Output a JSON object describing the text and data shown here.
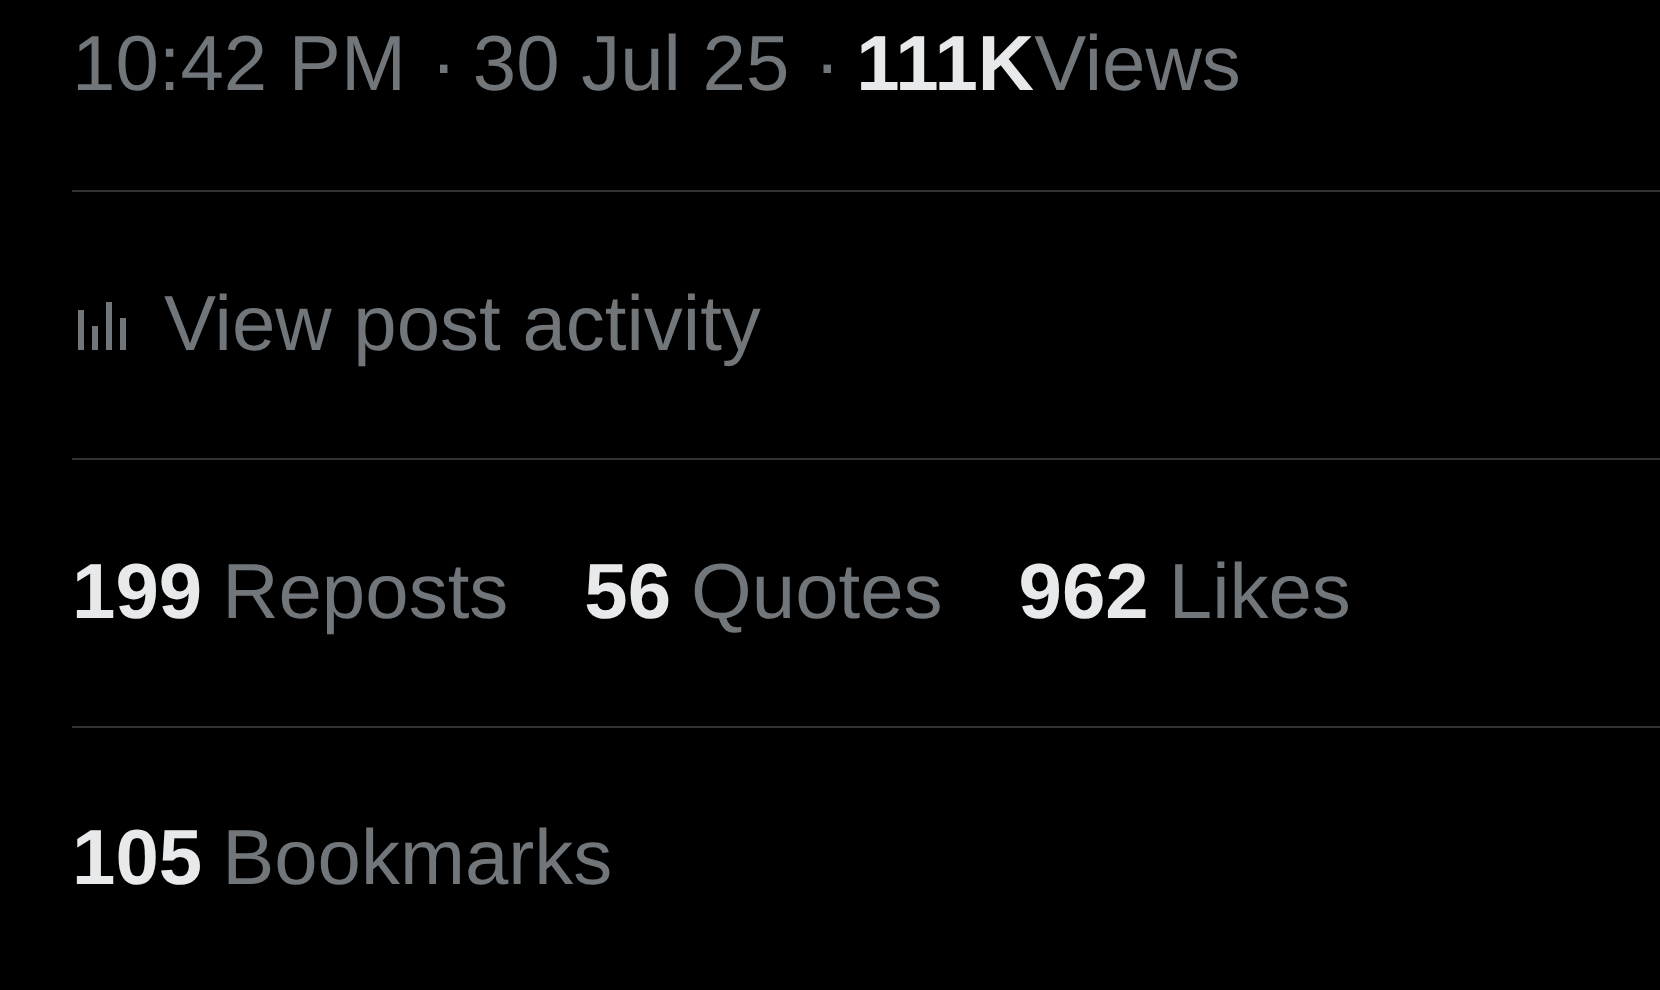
{
  "meta": [
    {
      "kind": "text",
      "text": "10:42 PM"
    },
    {
      "kind": "separator",
      "text": "·"
    },
    {
      "kind": "text",
      "text": "30 Jul 25"
    },
    {
      "kind": "separator",
      "text": "·"
    },
    {
      "kind": "count",
      "text": "111K"
    },
    {
      "kind": "text",
      "text": "Views"
    }
  ],
  "activity_link": {
    "label": "View post activity"
  },
  "stats": [
    {
      "count": "199",
      "label": "Reposts"
    },
    {
      "count": "56",
      "label": "Quotes"
    },
    {
      "count": "962",
      "label": "Likes"
    }
  ],
  "bookmarks": {
    "count": "105",
    "label": "Bookmarks"
  }
}
